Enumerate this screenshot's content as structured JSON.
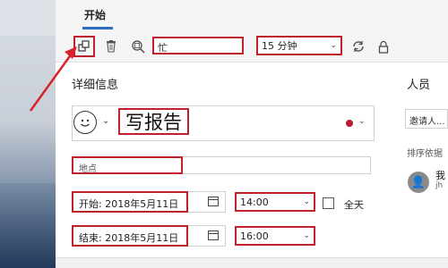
{
  "ribbon": {
    "tab_home": "开始"
  },
  "toolbar": {
    "busy_value": "忙",
    "reminder_value": "15 分钟"
  },
  "details": {
    "section_title": "详细信息",
    "subject": "写报告",
    "location_placeholder": "地点",
    "start_date": "开始: 2018年5月11日",
    "start_time": "14:00",
    "end_date": "结束: 2018年5月11日",
    "end_time": "16:00",
    "all_day_label": "全天"
  },
  "people": {
    "title": "人员",
    "invite_placeholder": "邀请人...",
    "sort_label": "排序依据",
    "person_name": "我",
    "person_sub": "jh"
  },
  "colors": {
    "highlight": "#c0202a",
    "category_dot": "#b3202d",
    "accent": "#2b6cc4"
  },
  "icons": [
    "switch-window-icon",
    "delete-icon",
    "scheduling-icon",
    "recurrence-icon",
    "lock-icon",
    "emoji-icon",
    "calendar-icon"
  ]
}
